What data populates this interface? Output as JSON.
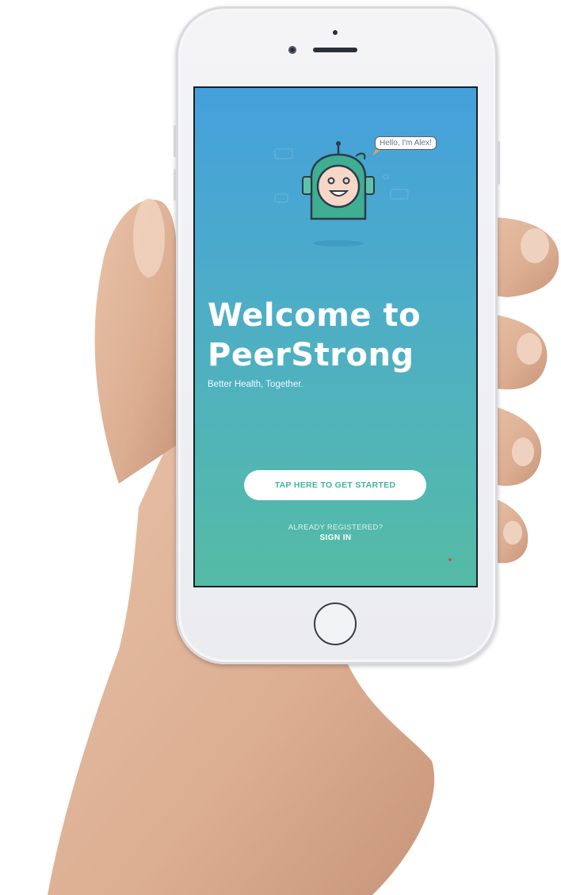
{
  "app": {
    "bubble_text": "Hello, I'm Alex!",
    "title": "Welcome to PeerStrong",
    "subtitle": "Better Health, Together.",
    "cta_label": "TAP HERE TO GET STARTED",
    "already_registered": "ALREADY REGISTERED?",
    "sign_in_label": "SIGN IN"
  },
  "colors": {
    "gradient_top": "#45a0dc",
    "gradient_bottom": "#55bba5",
    "cta_text": "#3fb4a3"
  },
  "icons": [
    "mascot-alex-icon",
    "speech-bubble-icon",
    "home-button-icon"
  ]
}
